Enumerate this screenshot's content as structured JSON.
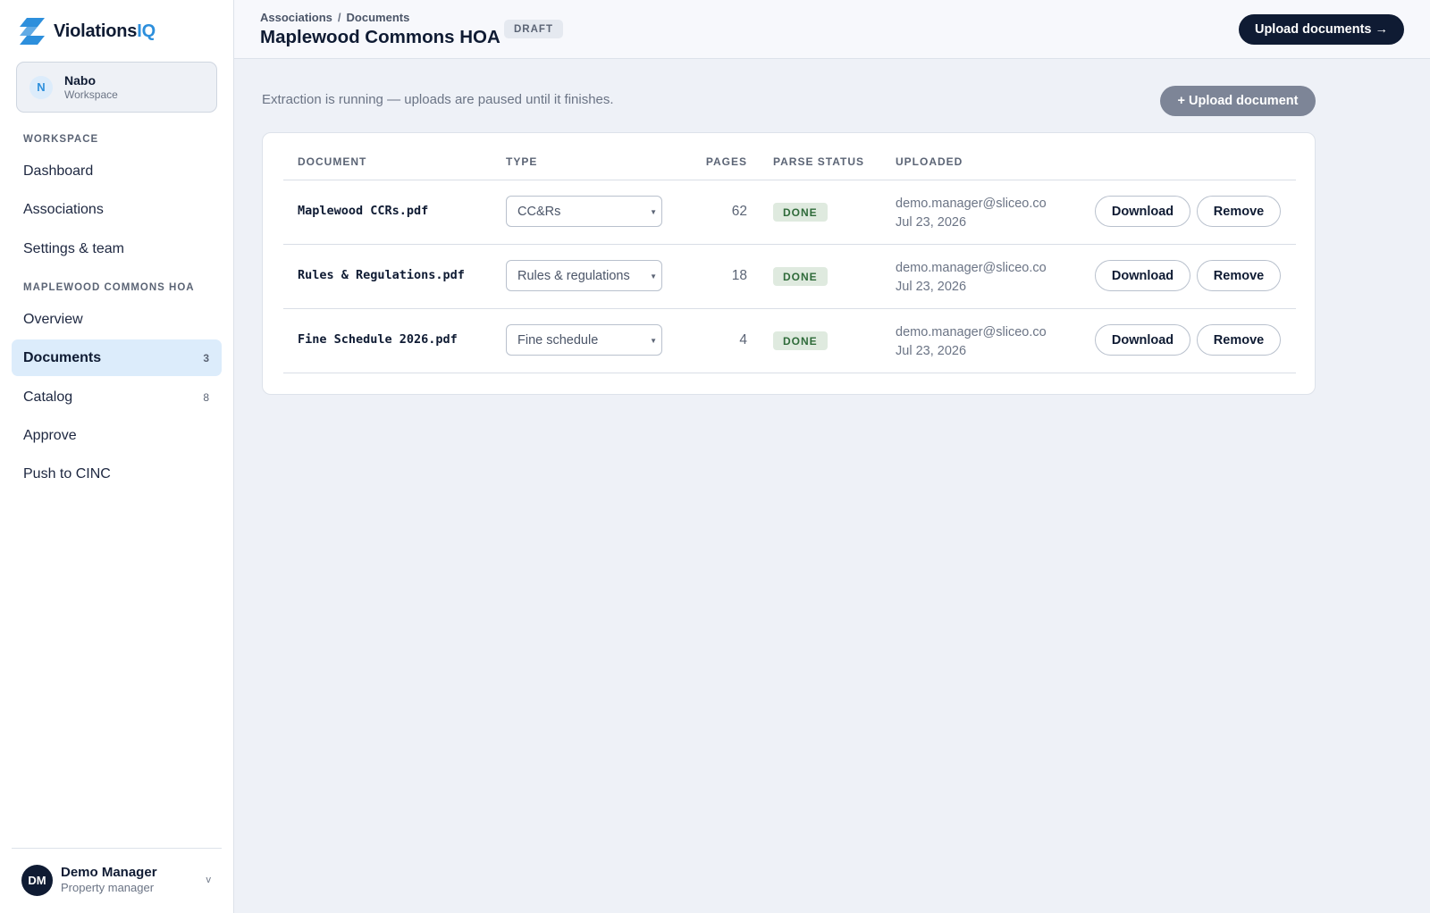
{
  "app": {
    "name_main": "Violations",
    "name_accent": "IQ",
    "accent_color": "#2d8fdc",
    "logo_icon": "lightning-logo-icon"
  },
  "workspace": {
    "initial": "N",
    "name": "Nabo",
    "subtitle": "Workspace"
  },
  "sidebar": {
    "workspace_section": "WORKSPACE",
    "workspace_items": [
      {
        "label": "Dashboard"
      },
      {
        "label": "Associations"
      },
      {
        "label": "Settings & team"
      }
    ],
    "association_section": "MAPLEWOOD COMMONS HOA",
    "association_items": [
      {
        "label": "Overview",
        "count": ""
      },
      {
        "label": "Documents",
        "count": "3",
        "active": true
      },
      {
        "label": "Catalog",
        "count": "8"
      },
      {
        "label": "Approve",
        "count": ""
      },
      {
        "label": "Push to CINC",
        "count": ""
      }
    ]
  },
  "user": {
    "initials": "DM",
    "name": "Demo Manager",
    "role": "Property manager",
    "chevron": "v"
  },
  "header": {
    "breadcrumb": [
      "Associations",
      "Documents"
    ],
    "breadcrumb_sep": "/",
    "title": "Maplewood Commons HOA",
    "badge": "DRAFT",
    "primary_button": "Upload documents →"
  },
  "main": {
    "notice": "Extraction is running — uploads are paused until it finishes.",
    "upload_button": "+ Upload document",
    "table": {
      "columns": [
        "DOCUMENT",
        "TYPE",
        "PAGES",
        "PARSE STATUS",
        "UPLOADED"
      ],
      "rows": [
        {
          "document": "Maplewood CCRs.pdf",
          "type": "CC&Rs",
          "pages": "62",
          "status": "DONE",
          "uploader": "demo.manager@sliceo.co",
          "date": "Jul 23, 2026",
          "download": "Download",
          "remove": "Remove"
        },
        {
          "document": "Rules & Regulations.pdf",
          "type": "Rules & regulations",
          "pages": "18",
          "status": "DONE",
          "uploader": "demo.manager@sliceo.co",
          "date": "Jul 23, 2026",
          "download": "Download",
          "remove": "Remove"
        },
        {
          "document": "Fine Schedule 2026.pdf",
          "type": "Fine schedule",
          "pages": "4",
          "status": "DONE",
          "uploader": "demo.manager@sliceo.co",
          "date": "Jul 23, 2026",
          "download": "Download",
          "remove": "Remove"
        }
      ]
    }
  }
}
